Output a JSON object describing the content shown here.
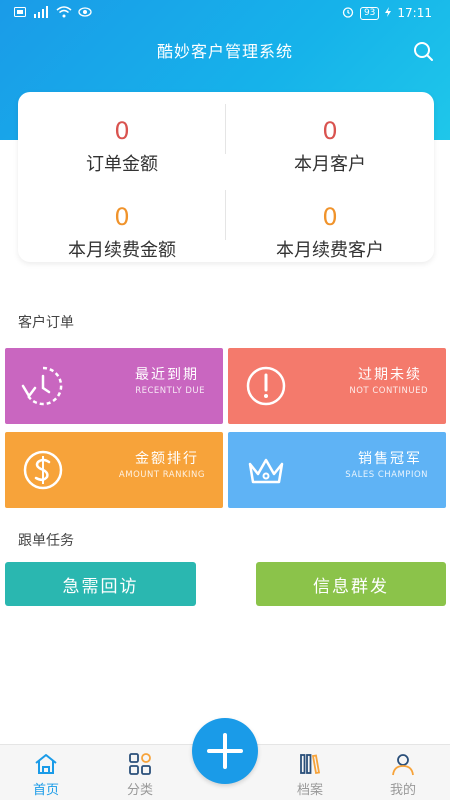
{
  "status_bar": {
    "time": "17:11",
    "battery": "93"
  },
  "header": {
    "title": "酷妙客户管理系统"
  },
  "summary": {
    "order_amount": {
      "value": "0",
      "label": "订单金额"
    },
    "month_customers": {
      "value": "0",
      "label": "本月客户"
    },
    "month_renewal_amount": {
      "value": "0",
      "label": "本月续费金额"
    },
    "month_renewal_customers": {
      "value": "0",
      "label": "本月续费客户"
    }
  },
  "sections": {
    "customer_orders": "客户订单",
    "follow_tasks": "跟单任务"
  },
  "tiles": [
    {
      "title": "最近到期",
      "subtitle": "RECENTLY DUE",
      "color": "#c966c0"
    },
    {
      "title": "过期未续",
      "subtitle": "NOT CONTINUED",
      "color": "#f47a6c"
    },
    {
      "title": "金额排行",
      "subtitle": "AMOUNT RANKING",
      "color": "#f7a33a"
    },
    {
      "title": "销售冠军",
      "subtitle": "SALES CHAMPION",
      "color": "#5fb3f5"
    }
  ],
  "tasks": {
    "urgent_visit": "急需回访",
    "mass_message": "信息群发"
  },
  "nav": {
    "home": "首页",
    "category": "分类",
    "archive": "档案",
    "mine": "我的"
  },
  "colors": {
    "accent": "#1a9be8",
    "teal": "#2ab7b0",
    "green": "#8bc34a",
    "red_value": "#d9534f",
    "orange_value": "#f0932b"
  }
}
